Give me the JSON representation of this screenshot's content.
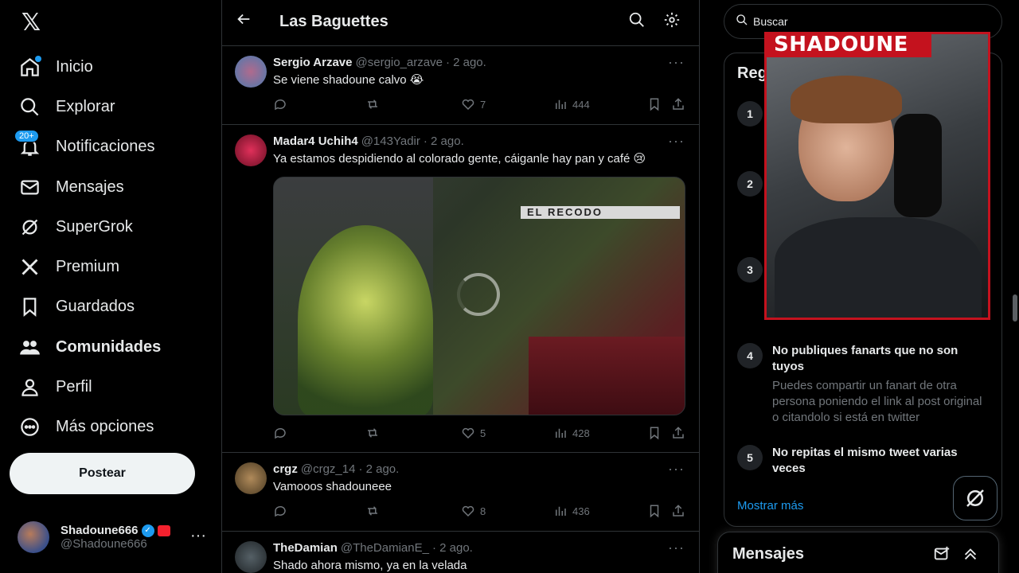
{
  "nav": {
    "items": [
      {
        "label": "Inicio",
        "icon": "home-icon"
      },
      {
        "label": "Explorar",
        "icon": "search-icon"
      },
      {
        "label": "Notificaciones",
        "icon": "bell-icon",
        "badge": "20+"
      },
      {
        "label": "Mensajes",
        "icon": "mail-icon"
      },
      {
        "label": "SuperGrok",
        "icon": "grok-icon"
      },
      {
        "label": "Premium",
        "icon": "x-logo-icon"
      },
      {
        "label": "Guardados",
        "icon": "bookmark-icon"
      },
      {
        "label": "Comunidades",
        "icon": "communities-icon"
      },
      {
        "label": "Perfil",
        "icon": "person-icon"
      },
      {
        "label": "Más opciones",
        "icon": "more-circle-icon"
      }
    ],
    "post_button": "Postear",
    "account": {
      "name": "Shadoune666",
      "handle": "@Shadoune666"
    }
  },
  "header": {
    "title": "Las Baguettes"
  },
  "tweets": [
    {
      "name": "Sergio Arzave",
      "handle": "@sergio_arzave",
      "time": "· 2 ago.",
      "text": "Se viene shadoune calvo 😭",
      "likes": "7",
      "views": "444"
    },
    {
      "name": "Madar4 Uchih4",
      "handle": "@143Yadir",
      "time": "· 2 ago.",
      "text": "Ya estamos despidiendo al colorado gente, cáiganle hay pan y café 😢",
      "likes": "5",
      "views": "428",
      "media_caption": "EL RECODO"
    },
    {
      "name": "crgz",
      "handle": "@crgz_14",
      "time": "· 2 ago.",
      "text": "Vamooos shadouneee",
      "likes": "8",
      "views": "436"
    },
    {
      "name": "TheDamian",
      "handle": "@TheDamianE_",
      "time": "· 2 ago.",
      "text": "Shado ahora mismo, ya en la velada"
    }
  ],
  "sidebar": {
    "search_placeholder": "Buscar",
    "rules_title": "Reg",
    "rules": [
      {
        "num": "1"
      },
      {
        "num": "2"
      },
      {
        "num": "3"
      },
      {
        "num": "4",
        "title": "No publiques fanarts que no son tuyos",
        "desc": "Puedes compartir un fanart de otra persona poniendo el link al post original o citandolo si está en twitter"
      },
      {
        "num": "5",
        "title": "No repitas el mismo tweet varias veces"
      }
    ],
    "show_more": "Mostrar más",
    "messages_title": "Mensajes"
  },
  "overlay": {
    "brand": "SHADOUNE"
  },
  "colors": {
    "accent": "#1d9bf0",
    "brand_red": "#c4121e",
    "background": "#000000",
    "muted": "#71767b"
  }
}
